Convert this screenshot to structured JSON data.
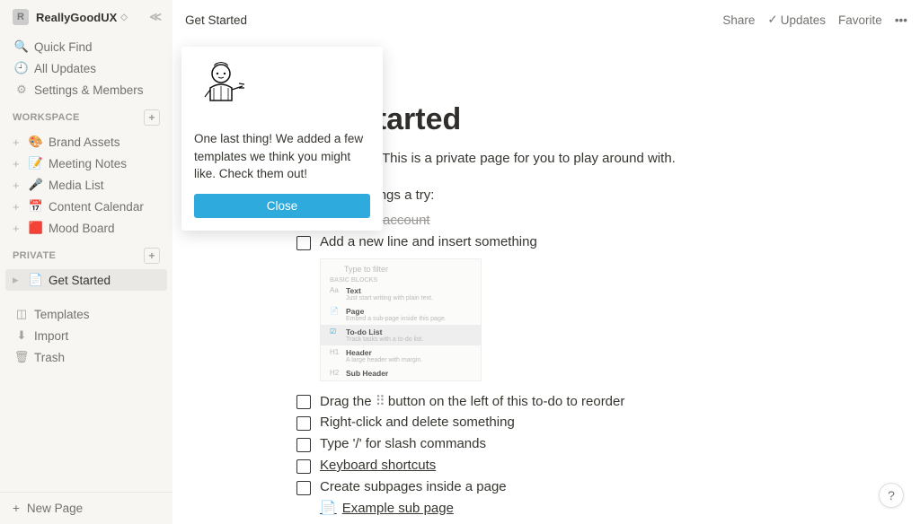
{
  "workspace": {
    "name": "ReallyGoodUX",
    "initial": "R"
  },
  "sidebar": {
    "quick": [
      {
        "icon": "🔍",
        "label": "Quick Find"
      },
      {
        "icon": "🕘",
        "label": "All Updates"
      },
      {
        "icon": "⚙",
        "label": "Settings & Members"
      }
    ],
    "workspace_label": "WORKSPACE",
    "workspace_items": [
      {
        "emoji": "🎨",
        "label": "Brand Assets"
      },
      {
        "emoji": "📝",
        "label": "Meeting Notes"
      },
      {
        "emoji": "🎤",
        "label": "Media List"
      },
      {
        "emoji": "📅",
        "label": "Content Calendar"
      },
      {
        "emoji": "🟥",
        "label": "Mood Board"
      }
    ],
    "private_label": "PRIVATE",
    "private_items": [
      {
        "emoji": "📄",
        "label": "Get Started"
      }
    ],
    "bottom": [
      {
        "icon": "◫",
        "label": "Templates"
      },
      {
        "icon": "⬇",
        "label": "Import"
      },
      {
        "icon": "🗑",
        "label": "Trash"
      }
    ],
    "new_page": "New Page"
  },
  "topbar": {
    "breadcrumb": "Get Started",
    "share": "Share",
    "updates": "Updates",
    "favorite": "Favorite"
  },
  "page": {
    "title": "Get Started",
    "desc_emoji": "👋",
    "desc": "Welcome! This is a private page for you to play around with.",
    "hint": "Give these things a try:",
    "todos": [
      {
        "checked": true,
        "text": "Create an account"
      },
      {
        "checked": false,
        "text": "Add a new line and insert something"
      },
      {
        "checked": false,
        "text_pre": "Drag the ",
        "text_post": " button on the left of this to-do to reorder",
        "drag": true
      },
      {
        "checked": false,
        "text": "Right-click and delete something"
      },
      {
        "checked": false,
        "text": "Type '/' for slash commands"
      },
      {
        "checked": false,
        "text": "Keyboard shortcuts",
        "link": true
      },
      {
        "checked": false,
        "text": "Create subpages inside a page"
      }
    ],
    "filter_preview": {
      "placeholder": "Type to filter",
      "section": "BASIC BLOCKS",
      "rows": [
        {
          "ic": "Aa",
          "title": "Text",
          "sub": "Just start writing with plain text."
        },
        {
          "ic": "📄",
          "title": "Page",
          "sub": "Embed a sub-page inside this page."
        },
        {
          "ic": "☑",
          "title": "To-do List",
          "sub": "Track tasks with a to-do list.",
          "hl": true
        },
        {
          "ic": "H1",
          "title": "Header",
          "sub": "A large header with margin."
        },
        {
          "ic": "H2",
          "title": "Sub Header",
          "sub": ""
        }
      ]
    },
    "subpage": "Example sub page"
  },
  "modal": {
    "text": "One last thing! We added a few templates we think you might like. Check them out!",
    "button": "Close"
  },
  "help": "?"
}
